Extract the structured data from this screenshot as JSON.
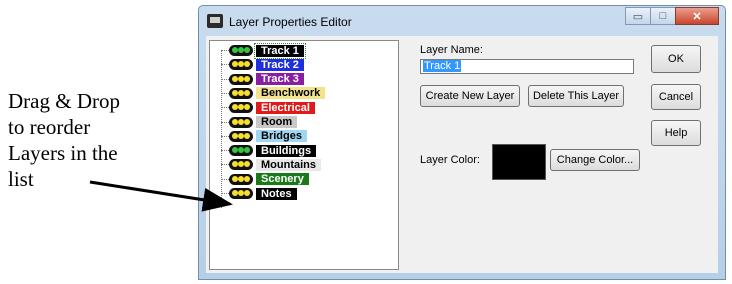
{
  "annotation": {
    "lines": [
      "Drag & Drop",
      "to reorder",
      "Layers in the",
      "list"
    ]
  },
  "window": {
    "title": "Layer Properties Editor",
    "buttons": {
      "minimize": "▭",
      "maximize": "□",
      "close": "✕"
    }
  },
  "layers": [
    {
      "name": "Track 1",
      "bg": "#000000",
      "fg": "#ffffff",
      "lamp": "green",
      "selected": true
    },
    {
      "name": "Track 2",
      "bg": "#1f2fe0",
      "fg": "#ffffff",
      "lamp": "yellow"
    },
    {
      "name": "Track 3",
      "bg": "#8a1ea3",
      "fg": "#ffffff",
      "lamp": "yellow"
    },
    {
      "name": "Benchwork",
      "bg": "#f2e48a",
      "fg": "#000000",
      "lamp": "yellow"
    },
    {
      "name": "Electrical",
      "bg": "#e01a1a",
      "fg": "#ffffff",
      "lamp": "yellow"
    },
    {
      "name": "Room",
      "bg": "#c8c8c8",
      "fg": "#000000",
      "lamp": "yellow"
    },
    {
      "name": "Bridges",
      "bg": "#9fd7f2",
      "fg": "#000000",
      "lamp": "yellow"
    },
    {
      "name": "Buildings",
      "bg": "#000000",
      "fg": "#ffffff",
      "lamp": "green"
    },
    {
      "name": "Mountains",
      "bg": "#e8e8e8",
      "fg": "#000000",
      "lamp": "yellow"
    },
    {
      "name": "Scenery",
      "bg": "#1a7a1a",
      "fg": "#ffffff",
      "lamp": "yellow"
    },
    {
      "name": "Notes",
      "bg": "#000000",
      "fg": "#ffffff",
      "lamp": "yellow"
    }
  ],
  "form": {
    "layer_name_label": "Layer Name:",
    "layer_name_value": "Track 1",
    "create_button": "Create New Layer",
    "delete_button": "Delete This Layer",
    "color_label": "Layer Color:",
    "layer_color": "#000000",
    "change_color_button": "Change Color..."
  },
  "actions": {
    "ok": "OK",
    "cancel": "Cancel",
    "help": "Help"
  }
}
